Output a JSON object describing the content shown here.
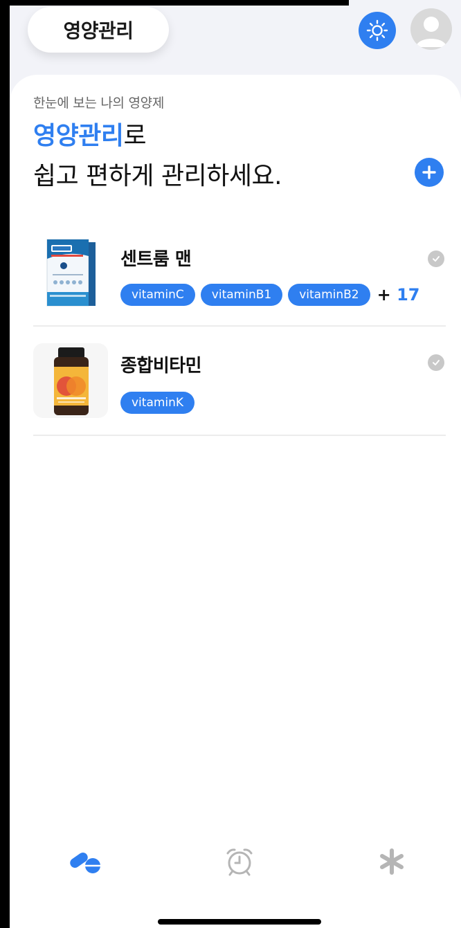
{
  "header": {
    "title": "영양관리",
    "theme_button": "sun-icon",
    "profile": "avatar"
  },
  "main": {
    "subtitle": "한눈에 보는 나의 영양제",
    "headline_accent": "영양관리",
    "headline_suffix": "로",
    "headline_line2": "쉽고 편하게 관리하세요.",
    "add_button": "plus-icon"
  },
  "supplements": [
    {
      "name": "센트룸 맨",
      "tags": [
        "vitaminC",
        "vitaminB1",
        "vitaminB2"
      ],
      "more_prefix": "+ ",
      "more_count": "17"
    },
    {
      "name": "종합비타민",
      "tags": [
        "vitaminK"
      ]
    }
  ],
  "nav": {
    "items": [
      "pills-icon",
      "alarm-clock-icon",
      "asterisk-icon"
    ],
    "active": "pills-icon"
  },
  "colors": {
    "accent": "#2f7ff0",
    "background": "#f2f3f8",
    "card": "#ffffff"
  }
}
